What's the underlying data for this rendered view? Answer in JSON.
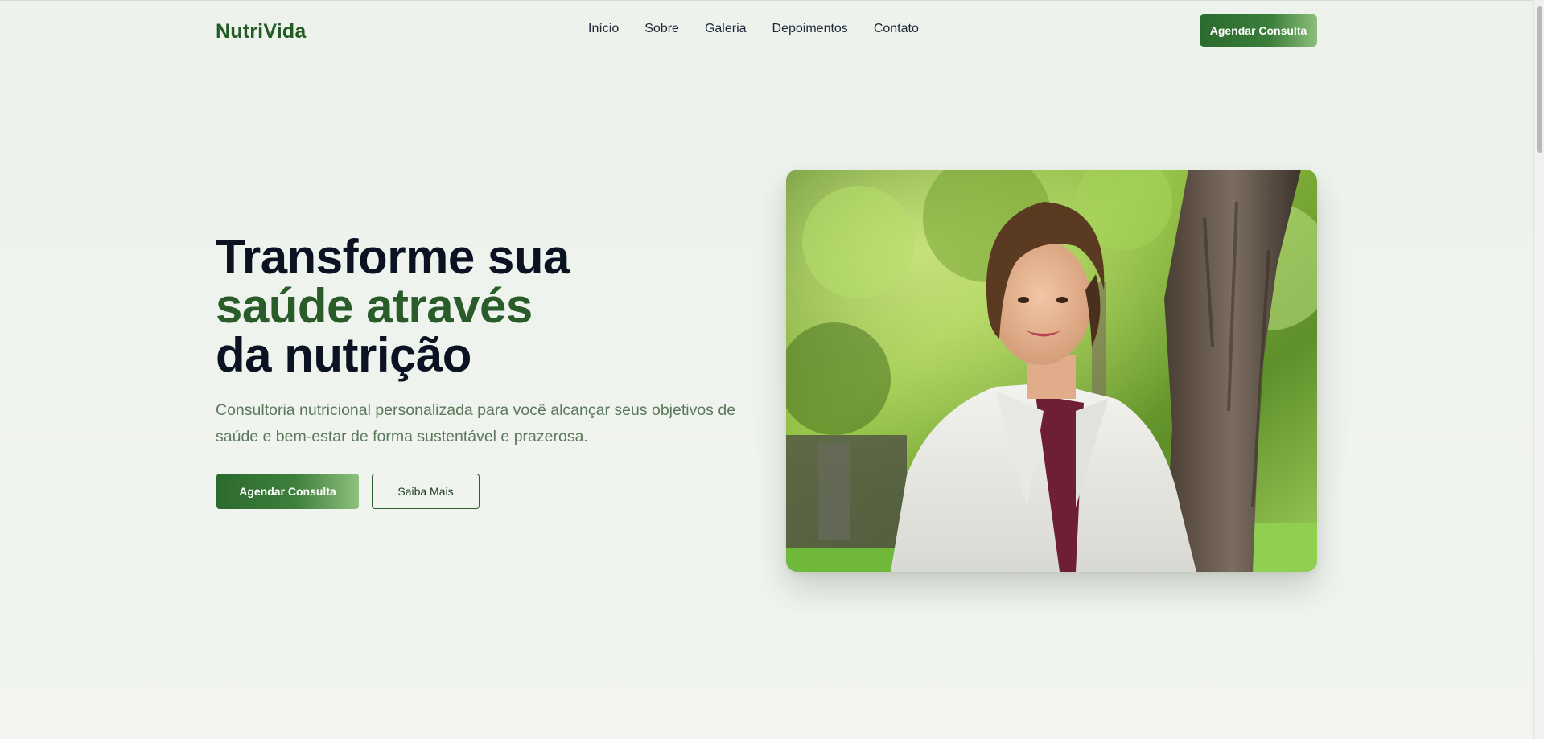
{
  "brand": {
    "logo": "NutriVida",
    "accent_color": "#235b24"
  },
  "nav": {
    "items": [
      "Início",
      "Sobre",
      "Galeria",
      "Depoimentos",
      "Contato"
    ]
  },
  "header": {
    "cta_label": "Agendar Consulta"
  },
  "hero": {
    "title_line1": "Transforme sua",
    "title_line2": "saúde através",
    "title_line3": "da nutrição",
    "subtitle": "Consultoria nutricional personalizada para você alcançar seus objetivos de saúde e bem-estar de forma sustentável e prazerosa.",
    "primary_button": "Agendar Consulta",
    "secondary_button": "Saiba Mais",
    "image_icon": "portrait-photo-nutritionist"
  }
}
